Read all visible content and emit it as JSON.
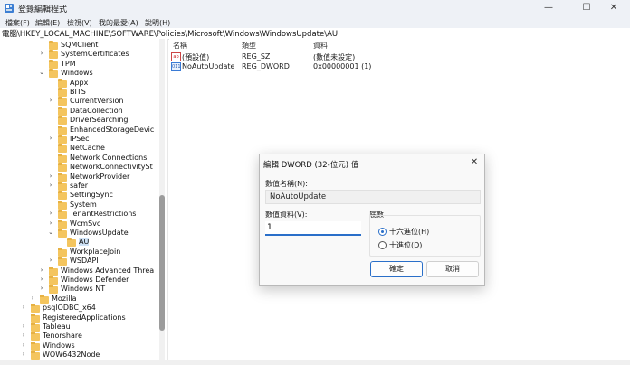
{
  "window": {
    "title": "登錄編輯程式",
    "controls": {
      "minimize": "—",
      "maximize": "☐",
      "close": "✕"
    }
  },
  "menu": [
    "檔案(F)",
    "編輯(E)",
    "檢視(V)",
    "我的最愛(A)",
    "說明(H)"
  ],
  "address": "電腦\\HKEY_LOCAL_MACHINE\\SOFTWARE\\Policies\\Microsoft\\Windows\\WindowsUpdate\\AU",
  "tree": [
    {
      "label": "SQMClient",
      "indent": 4,
      "chev": "",
      "selected": false
    },
    {
      "label": "SystemCertificates",
      "indent": 4,
      "chev": "›",
      "selected": false
    },
    {
      "label": "TPM",
      "indent": 4,
      "chev": "",
      "selected": false
    },
    {
      "label": "Windows",
      "indent": 4,
      "chev": "⌄",
      "selected": false
    },
    {
      "label": "Appx",
      "indent": 5,
      "chev": "",
      "selected": false
    },
    {
      "label": "BITS",
      "indent": 5,
      "chev": "",
      "selected": false
    },
    {
      "label": "CurrentVersion",
      "indent": 5,
      "chev": "›",
      "selected": false
    },
    {
      "label": "DataCollection",
      "indent": 5,
      "chev": "",
      "selected": false
    },
    {
      "label": "DriverSearching",
      "indent": 5,
      "chev": "",
      "selected": false
    },
    {
      "label": "EnhancedStorageDevic",
      "indent": 5,
      "chev": "",
      "selected": false
    },
    {
      "label": "IPSec",
      "indent": 5,
      "chev": "›",
      "selected": false
    },
    {
      "label": "NetCache",
      "indent": 5,
      "chev": "",
      "selected": false
    },
    {
      "label": "Network Connections",
      "indent": 5,
      "chev": "",
      "selected": false
    },
    {
      "label": "NetworkConnectivitySt",
      "indent": 5,
      "chev": "",
      "selected": false
    },
    {
      "label": "NetworkProvider",
      "indent": 5,
      "chev": "›",
      "selected": false
    },
    {
      "label": "safer",
      "indent": 5,
      "chev": "›",
      "selected": false
    },
    {
      "label": "SettingSync",
      "indent": 5,
      "chev": "",
      "selected": false
    },
    {
      "label": "System",
      "indent": 5,
      "chev": "",
      "selected": false
    },
    {
      "label": "TenantRestrictions",
      "indent": 5,
      "chev": "›",
      "selected": false
    },
    {
      "label": "WcmSvc",
      "indent": 5,
      "chev": "›",
      "selected": false
    },
    {
      "label": "WindowsUpdate",
      "indent": 5,
      "chev": "⌄",
      "selected": false
    },
    {
      "label": "AU",
      "indent": 6,
      "chev": "",
      "selected": true
    },
    {
      "label": "WorkplaceJoin",
      "indent": 5,
      "chev": "",
      "selected": false
    },
    {
      "label": "WSDAPI",
      "indent": 5,
      "chev": "›",
      "selected": false
    },
    {
      "label": "Windows Advanced Threa",
      "indent": 4,
      "chev": "›",
      "selected": false
    },
    {
      "label": "Windows Defender",
      "indent": 4,
      "chev": "›",
      "selected": false
    },
    {
      "label": "Windows NT",
      "indent": 4,
      "chev": "›",
      "selected": false
    },
    {
      "label": "Mozilla",
      "indent": 3,
      "chev": "›",
      "selected": false
    },
    {
      "label": "psqlODBC_x64",
      "indent": 2,
      "chev": "›",
      "selected": false
    },
    {
      "label": "RegisteredApplications",
      "indent": 2,
      "chev": "",
      "selected": false
    },
    {
      "label": "Tableau",
      "indent": 2,
      "chev": "›",
      "selected": false
    },
    {
      "label": "Tenorshare",
      "indent": 2,
      "chev": "›",
      "selected": false
    },
    {
      "label": "Windows",
      "indent": 2,
      "chev": "›",
      "selected": false
    },
    {
      "label": "WOW6432Node",
      "indent": 2,
      "chev": "›",
      "selected": false
    }
  ],
  "list": {
    "headers": {
      "name": "名稱",
      "type": "類型",
      "data": "資料"
    },
    "rows": [
      {
        "icon": "ab",
        "name": "(預設值)",
        "type": "REG_SZ",
        "data": "(數值未設定)"
      },
      {
        "icon": "011",
        "name": "NoAutoUpdate",
        "type": "REG_DWORD",
        "data": "0x00000001 (1)"
      }
    ]
  },
  "dialog": {
    "title": "編輯 DWORD (32-位元) 值",
    "close": "✕",
    "name_label": "數值名稱(N):",
    "name_value": "NoAutoUpdate",
    "data_label": "數值資料(V):",
    "data_value": "1",
    "base_label": "底數",
    "base_options": [
      {
        "label": "十六進位(H)",
        "selected": true
      },
      {
        "label": "十進位(D)",
        "selected": false
      }
    ],
    "ok": "確定",
    "cancel": "取消"
  },
  "colors": {
    "accent": "#2a6fc9",
    "folder": "#f4c55e",
    "selected": "#cfe3f7"
  }
}
